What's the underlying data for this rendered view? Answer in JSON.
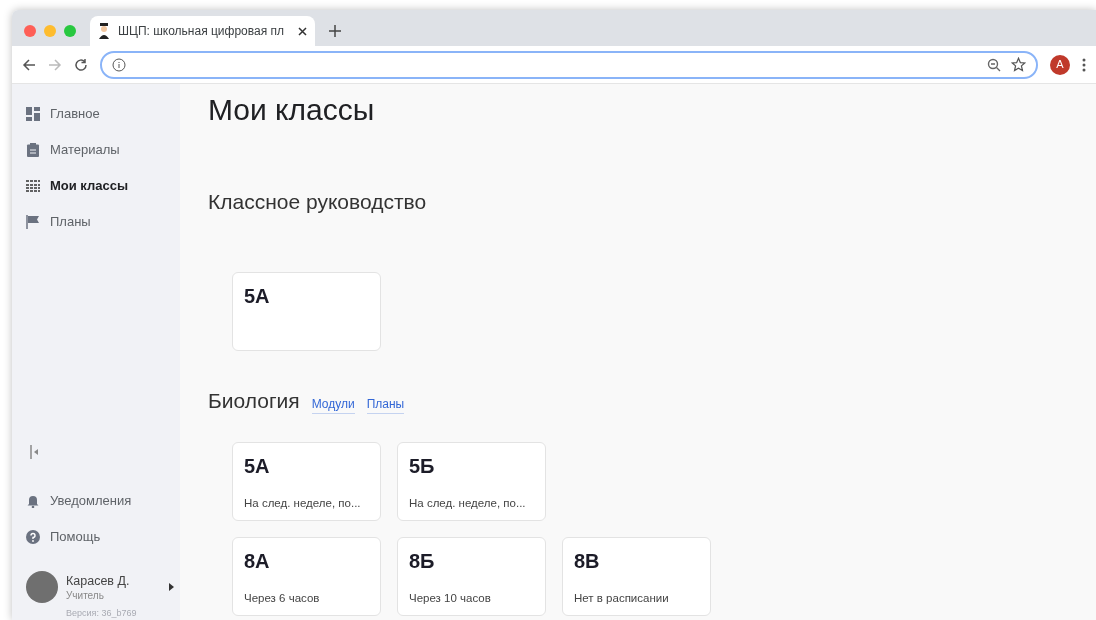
{
  "browser": {
    "tab_title": "ШЦП: школьная цифровая пл",
    "profile_initial": "A"
  },
  "sidebar": {
    "items": [
      {
        "label": "Главное",
        "selected": false
      },
      {
        "label": "Материалы",
        "selected": false
      },
      {
        "label": "Мои классы",
        "selected": true
      },
      {
        "label": "Планы",
        "selected": false
      }
    ],
    "bottom_items": [
      {
        "label": "Уведомления"
      },
      {
        "label": "Помощь"
      }
    ],
    "user": {
      "name": "Карасев Д.",
      "role": "Учитель"
    },
    "version": "Версия: 36_b769"
  },
  "page_title": "Мои классы",
  "sections": [
    {
      "title": "Классное руководство",
      "card_rows": [
        [
          {
            "name": "5А"
          }
        ]
      ]
    },
    {
      "title": "Биология",
      "links": [
        "Модули",
        "Планы"
      ],
      "card_rows": [
        [
          {
            "name": "5А",
            "note": "На след. неделе, по..."
          },
          {
            "name": "5Б",
            "note": "На след. неделе, по..."
          }
        ],
        [
          {
            "name": "8А",
            "note": "Через 6 часов"
          },
          {
            "name": "8Б",
            "note": "Через 10 часов"
          },
          {
            "name": "8В",
            "note": "Нет в расписании"
          }
        ]
      ]
    }
  ]
}
